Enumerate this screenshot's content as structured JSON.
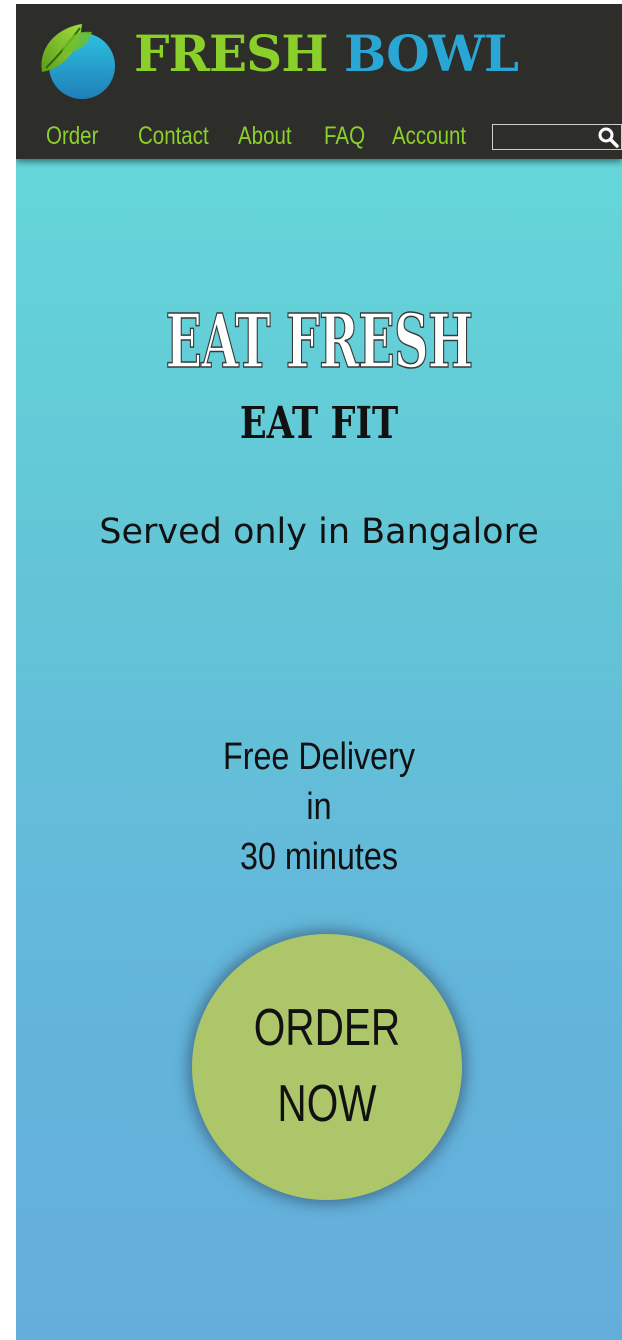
{
  "colors": {
    "brand_green": "#8bd02a",
    "brand_blue": "#2aa6d4",
    "header_bg": "#2d2d2a",
    "button": "#adc66a"
  },
  "header": {
    "logo": {
      "icon": "bowl-leaf-icon",
      "word1": "FRESH",
      "word2": "BOWL"
    },
    "nav": {
      "items": [
        "Order",
        "Contact",
        "About",
        "FAQ",
        "Account"
      ]
    },
    "search": {
      "value": "",
      "placeholder": "",
      "icon": "search-icon"
    }
  },
  "hero": {
    "title": "EAT FRESH",
    "subtitle": "EAT FIT",
    "served": "Served only in Bangalore",
    "delivery_line1": "Free Delivery",
    "delivery_line2": "in",
    "delivery_line3": "30 minutes",
    "order_button": "ORDER\nNOW"
  }
}
